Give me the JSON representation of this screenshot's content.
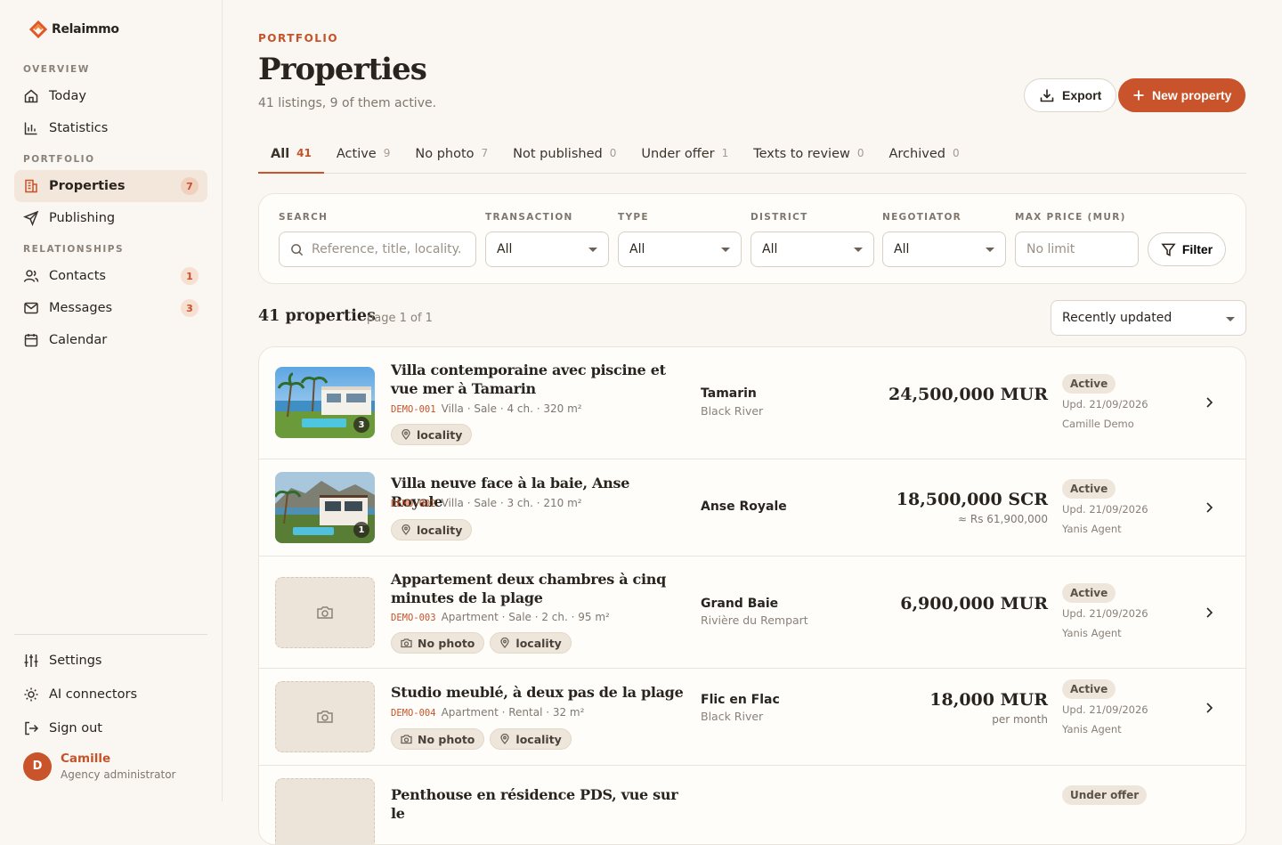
{
  "brand": {
    "name": "Relaimmo",
    "accent": "#c9532a"
  },
  "sidebar": {
    "sections": {
      "overview": "OVERVIEW",
      "portfolio": "PORTFOLIO",
      "relationships": "RELATIONSHIPS"
    },
    "items": [
      {
        "label": "Today",
        "icon": "home-icon"
      },
      {
        "label": "Statistics",
        "icon": "bar-chart-icon"
      },
      {
        "label": "Properties",
        "icon": "building-icon",
        "count": "7",
        "active": true
      },
      {
        "label": "Publishing",
        "icon": "send-icon"
      },
      {
        "label": "Contacts",
        "icon": "users-icon",
        "count": "1"
      },
      {
        "label": "Messages",
        "icon": "mail-icon",
        "count": "3"
      },
      {
        "label": "Calendar",
        "icon": "calendar-icon"
      }
    ],
    "bottom": [
      {
        "label": "Settings",
        "icon": "sliders-icon"
      },
      {
        "label": "AI connectors",
        "icon": "sun-icon"
      },
      {
        "label": "Sign out",
        "icon": "sign-out-icon"
      }
    ],
    "user": {
      "initial": "D",
      "name": "Camille",
      "role": "Agency administrator"
    }
  },
  "header": {
    "eyebrow": "PORTFOLIO",
    "title": "Properties",
    "subtitle": "41 listings, 9 of them active.",
    "export_label": "Export",
    "new_label": "New property"
  },
  "tabs": [
    {
      "label": "All",
      "count": "41",
      "active": true
    },
    {
      "label": "Active",
      "count": "9"
    },
    {
      "label": "No photo",
      "count": "7"
    },
    {
      "label": "Not published",
      "count": "0"
    },
    {
      "label": "Under offer",
      "count": "1"
    },
    {
      "label": "Texts to review",
      "count": "0"
    },
    {
      "label": "Archived",
      "count": "0"
    }
  ],
  "filters": {
    "search": {
      "label": "SEARCH",
      "placeholder": "Reference, title, locality."
    },
    "transaction": {
      "label": "TRANSACTION",
      "value": "All"
    },
    "type": {
      "label": "TYPE",
      "value": "All"
    },
    "district": {
      "label": "DISTRICT",
      "value": "All"
    },
    "negotiator": {
      "label": "NEGOTIATOR",
      "value": "All"
    },
    "max_price": {
      "label": "MAX PRICE (MUR)",
      "placeholder": "No limit"
    },
    "filter_label": "Filter"
  },
  "results": {
    "count": "41 properties",
    "page": "page 1 of 1",
    "sort": "Recently updated"
  },
  "properties": [
    {
      "title": "Villa contemporaine avec piscine et vue mer à Tamarin",
      "ref": "DEMO-001",
      "meta": "Villa · Sale · 4 ch. · 320 m²",
      "chips": [
        "locality"
      ],
      "photos": "3",
      "loc1": "Tamarin",
      "loc2": "Black River",
      "price": "24,500,000 MUR",
      "price_sub": "",
      "status": "Active",
      "updated": "Upd. 21/09/2026",
      "agent": "Camille Demo"
    },
    {
      "title": "Villa neuve face à la baie, Anse Royale",
      "ref": "DEMO-002",
      "meta": "Villa · Sale · 3 ch. · 210 m²",
      "chips": [
        "locality"
      ],
      "photos": "1",
      "loc1": "Anse Royale",
      "loc2": "",
      "price": "18,500,000 SCR",
      "price_sub": "≈ Rs 61,900,000",
      "status": "Active",
      "updated": "Upd. 21/09/2026",
      "agent": "Yanis Agent"
    },
    {
      "title": "Appartement deux chambres à cinq minutes de la plage",
      "ref": "DEMO-003",
      "meta": "Apartment · Sale · 2 ch. · 95 m²",
      "chips": [
        "No photo",
        "locality"
      ],
      "photos": "",
      "loc1": "Grand Baie",
      "loc2": "Rivière du Rempart",
      "price": "6,900,000 MUR",
      "price_sub": "",
      "status": "Active",
      "updated": "Upd. 21/09/2026",
      "agent": "Yanis Agent"
    },
    {
      "title": "Studio meublé, à deux pas de la plage",
      "ref": "DEMO-004",
      "meta": "Apartment · Rental · 32 m²",
      "chips": [
        "No photo",
        "locality"
      ],
      "photos": "",
      "loc1": "Flic en Flac",
      "loc2": "Black River",
      "price": "18,000 MUR",
      "price_sub": "per month",
      "status": "Active",
      "updated": "Upd. 21/09/2026",
      "agent": "Yanis Agent"
    },
    {
      "title": "Penthouse en résidence PDS, vue sur le",
      "ref": "",
      "meta": "",
      "chips": [],
      "photos": "",
      "loc1": "",
      "loc2": "",
      "price": "",
      "price_sub": "",
      "status": "Under offer",
      "updated": "",
      "agent": ""
    }
  ]
}
